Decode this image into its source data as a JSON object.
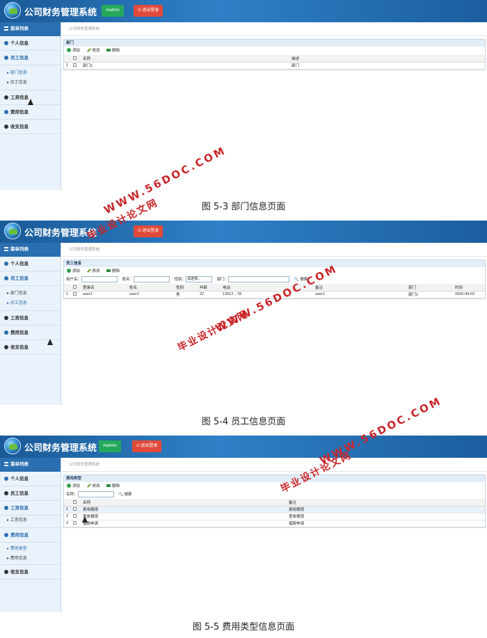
{
  "app": {
    "title": "公司财务管理系统",
    "user_label": "#admin",
    "logout_label": "⏻ 退出登录"
  },
  "menu": {
    "header": "菜单列表",
    "personal": "个人信息",
    "staff": "员工信息",
    "dept_sub": "部门信息",
    "staff_sub": "员工信息",
    "salary": "工资信息",
    "salary_sub": "工资信息",
    "expense": "费用信息",
    "expense_type_sub": "费用类型",
    "expense_info_sub": "费用信息",
    "income": "收支信息"
  },
  "breadcrumb": "公司财务管理系统",
  "toolbar": {
    "add": "添加",
    "edit": "修改",
    "delete": "删除"
  },
  "screens": [
    {
      "panel_title": "部门",
      "columns": [
        "名称",
        "描述"
      ],
      "rows": [
        {
          "no": "1",
          "cells": [
            "部门1",
            "部门"
          ]
        }
      ],
      "caption": "图 5-3 部门信息页面"
    },
    {
      "panel_title": "员工信息",
      "search": {
        "username_label": "用户名：",
        "name_label": "姓名：",
        "gender_label": "性别：",
        "gender_value": "请选择...",
        "dept_label": "部门：",
        "button": "搜索"
      },
      "columns": [
        "登录名",
        "姓名",
        "性别",
        "年龄",
        "电话",
        "备注",
        "部门",
        "时间"
      ],
      "rows": [
        {
          "no": "1",
          "cells": [
            "user1",
            "user1",
            "男",
            "22",
            "13012…78",
            "user1",
            "部门1",
            "2020-04-02"
          ]
        }
      ],
      "caption": "图 5-4 员工信息页面"
    },
    {
      "panel_title": "费用类型",
      "search": {
        "name_label": "名称：",
        "button": "搜索"
      },
      "columns": [
        "名称",
        "备注"
      ],
      "rows": [
        {
          "no": "1",
          "cells": [
            "费用报销",
            "费用报销"
          ]
        },
        {
          "no": "2",
          "cells": [
            "差旅报销",
            "差旅报销"
          ]
        },
        {
          "no": "3",
          "cells": [
            "借款申请",
            "借款申请"
          ]
        }
      ],
      "caption": "图 5-5 费用类型信息页面"
    }
  ],
  "watermark": {
    "url": "WWW.56DOC.COM",
    "site": "毕业设计论文网"
  },
  "colors": {
    "header": "#2f80c6",
    "sidebar": "#eaf2fb",
    "admin_btn": "#24a95b",
    "logout_btn": "#e14a3b",
    "watermark": "#c8262a"
  }
}
